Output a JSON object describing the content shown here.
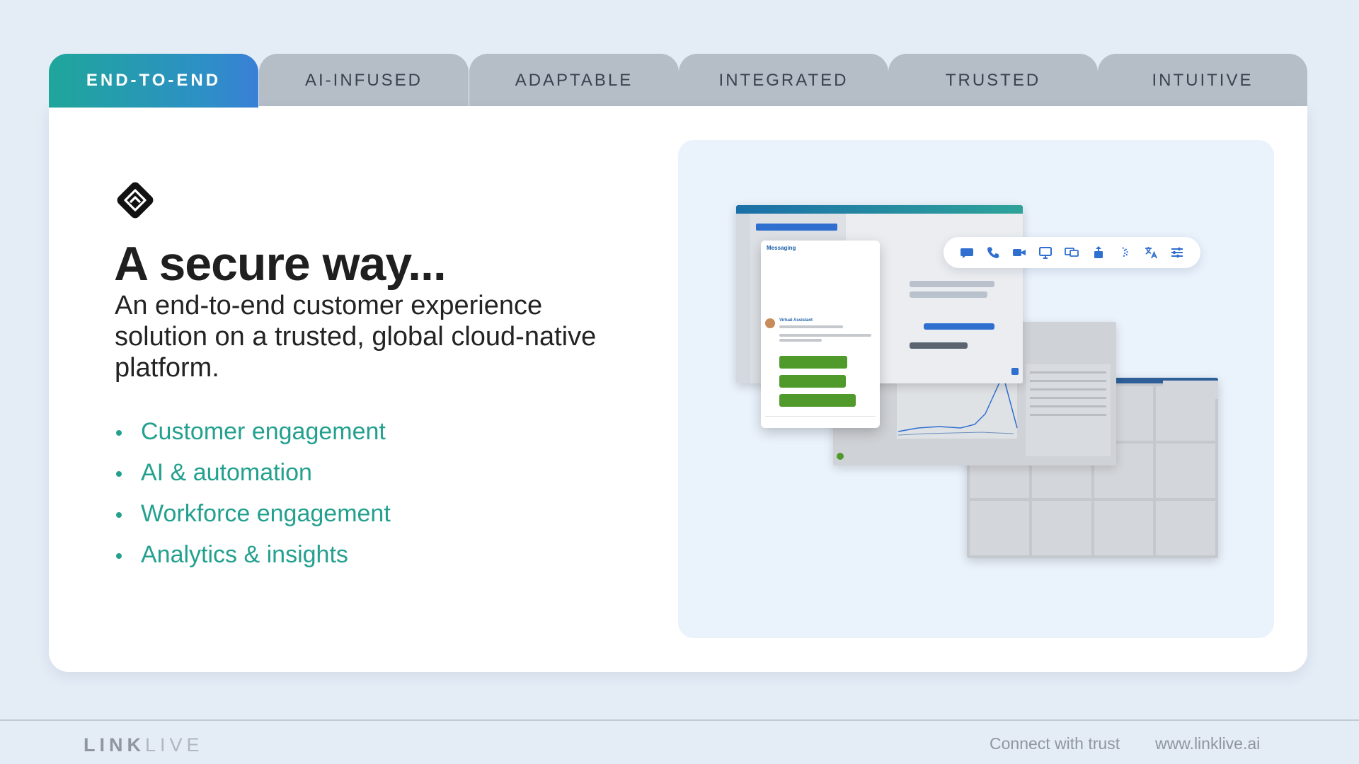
{
  "tabs": [
    {
      "label": "END-TO-END",
      "active": true
    },
    {
      "label": "AI-INFUSED",
      "active": false
    },
    {
      "label": "ADAPTABLE",
      "active": false
    },
    {
      "label": "INTEGRATED",
      "active": false
    },
    {
      "label": "TRUSTED",
      "active": false
    },
    {
      "label": "INTUITIVE",
      "active": false
    }
  ],
  "hero": {
    "logo_icon": "linklive-diamond-icon",
    "title": "A secure way...",
    "subtitle": "An end-to-end customer experience solution on a trusted, global cloud-native platform.",
    "features": [
      "Customer engagement",
      "AI & automation",
      "Workforce engagement",
      "Analytics & insights"
    ]
  },
  "preview": {
    "messaging_title": "Messaging",
    "assistant_name": "Virtual Assistant",
    "toolbar_icons": [
      "chat-icon",
      "phone-icon",
      "video-icon",
      "screen-share-icon",
      "cobrowse-icon",
      "transfer-icon",
      "signal-icon",
      "translate-icon",
      "settings-sliders-icon"
    ]
  },
  "footer": {
    "brand_bold": "LINK",
    "brand_light": "LIVE",
    "tagline": "Connect with trust",
    "website": "www.linklive.ai"
  },
  "colors": {
    "accent_teal": "#23a08e",
    "tab_gradient_start": "#1fa69b",
    "tab_gradient_end": "#3a7fd6",
    "tab_inactive": "#b5bec7",
    "background": "#e4ecf6",
    "icon_blue": "#2f6fd0"
  }
}
